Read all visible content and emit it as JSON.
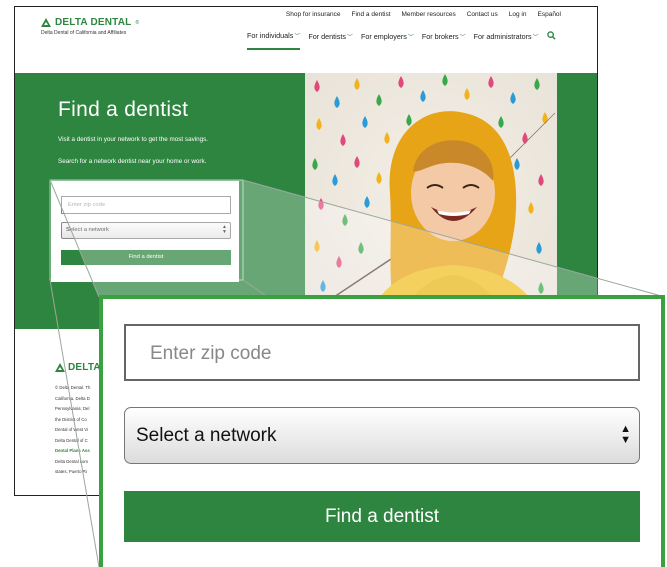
{
  "brand": {
    "logo_text": "DELTA DENTAL",
    "logo_tm": "®",
    "tagline": "Delta Dental of California and Affiliates",
    "primary_color": "#2e8540"
  },
  "utility_nav": [
    "Shop for insurance",
    "Find a dentist",
    "Member resources",
    "Contact us",
    "Log in",
    "Español"
  ],
  "main_nav": [
    {
      "label": "For individuals",
      "active": true
    },
    {
      "label": "For dentists",
      "active": false
    },
    {
      "label": "For employers",
      "active": false
    },
    {
      "label": "For brokers",
      "active": false
    },
    {
      "label": "For administrators",
      "active": false
    }
  ],
  "nav_icons": {
    "chevron": "chevron-down-icon",
    "search": "search-icon"
  },
  "hero": {
    "title": "Find a dentist",
    "line1": "Visit a dentist in your network to get the most savings.",
    "line2": "Search for a network dentist near your home or work."
  },
  "form": {
    "zip_placeholder": "Enter zip code",
    "network_selected": "Select a network",
    "submit_label": "Find a dentist"
  },
  "footer": {
    "logo_text": "DELTA",
    "lines": [
      "© Delta Dental. Th",
      "California. Delta D",
      "Pennsylvania; Del",
      "the District of Co",
      "Dental of West Vi",
      "Delta Dental of C",
      "Dental Plans Ass",
      "Delta Dental com",
      "states, Puerto Ri"
    ],
    "highlight_line_index": 6
  },
  "zoom_callout": {
    "zip_placeholder": "Enter zip code",
    "network_selected": "Select a network",
    "submit_label": "Find a dentist",
    "border_color": "#3aa040"
  }
}
